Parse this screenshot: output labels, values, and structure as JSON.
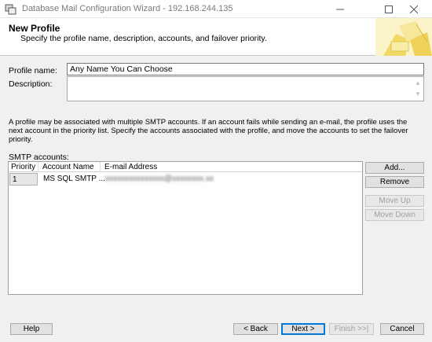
{
  "window": {
    "title": "Database Mail Configuration Wizard - 192.168.244.135",
    "icons": [
      "app-icon",
      "minimize-icon",
      "maximize-icon",
      "close-icon"
    ]
  },
  "header": {
    "title": "New Profile",
    "subtitle": "Specify the profile name, description, accounts, and failover priority."
  },
  "form": {
    "profile_name_label": "Profile name:",
    "profile_name_value": "Any Name You Can Choose",
    "description_label": "Description:",
    "description_value": "",
    "info_text": "A profile may be associated with multiple SMTP accounts. If an account fails while sending an e-mail, the profile uses the next account in the priority list. Specify the accounts associated with the profile, and move the accounts to set the failover priority."
  },
  "smtp": {
    "label": "SMTP accounts:",
    "columns": [
      "Priority",
      "Account Name",
      "E-mail Address"
    ],
    "rows": [
      {
        "priority": "1",
        "account_name": "MS SQL SMTP ...",
        "email": "xxxxxxxxxxxxxxx@xxxxxxxx.xx"
      }
    ],
    "buttons": {
      "add": "Add...",
      "remove": "Remove",
      "move_up": "Move Up",
      "move_down": "Move Down"
    }
  },
  "footer": {
    "help": "Help",
    "back": "< Back",
    "next": "Next >",
    "finish": "Finish >>|",
    "cancel": "Cancel"
  },
  "colors": {
    "accent": "#0078d7",
    "window_bg": "#f0f0f0",
    "header_bg": "#ffffff",
    "graphic_yellow": "#f5e27a"
  }
}
